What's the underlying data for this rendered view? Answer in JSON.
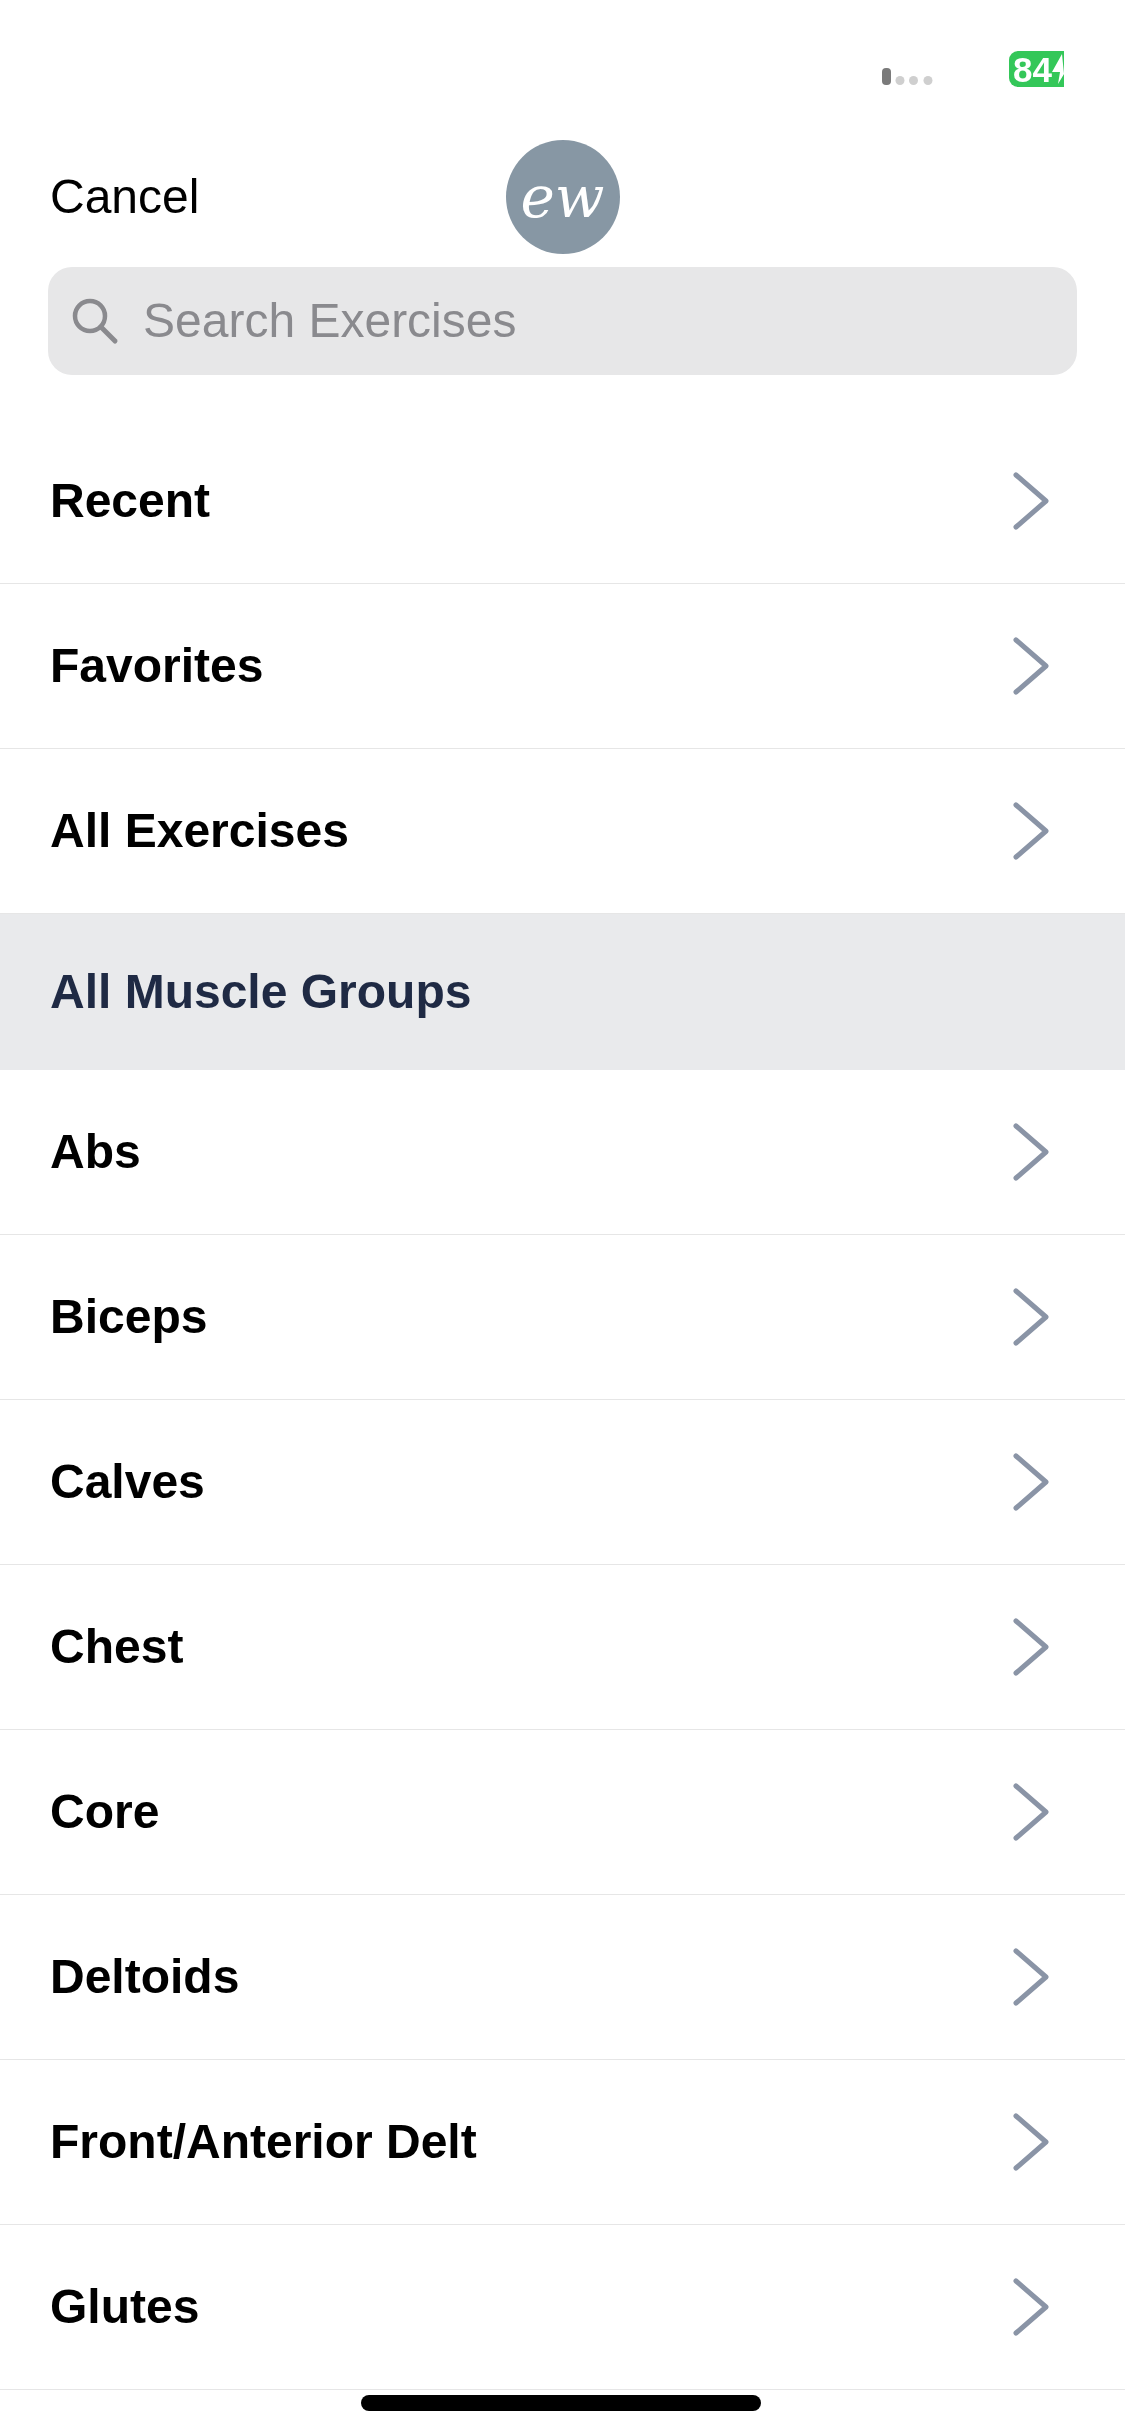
{
  "status_bar": {
    "battery": "84"
  },
  "header": {
    "cancel": "Cancel",
    "logo_text": "ew"
  },
  "search": {
    "placeholder": "Search Exercises"
  },
  "list": [
    {
      "kind": "row",
      "label": "Recent"
    },
    {
      "kind": "row",
      "label": "Favorites"
    },
    {
      "kind": "row",
      "label": "All Exercises"
    },
    {
      "kind": "section",
      "label": "All Muscle Groups"
    },
    {
      "kind": "row",
      "label": "Abs"
    },
    {
      "kind": "row",
      "label": "Biceps"
    },
    {
      "kind": "row",
      "label": "Calves"
    },
    {
      "kind": "row",
      "label": "Chest"
    },
    {
      "kind": "row",
      "label": "Core"
    },
    {
      "kind": "row",
      "label": "Deltoids"
    },
    {
      "kind": "row",
      "label": "Front/Anterior Delt"
    },
    {
      "kind": "row",
      "label": "Glutes"
    }
  ]
}
